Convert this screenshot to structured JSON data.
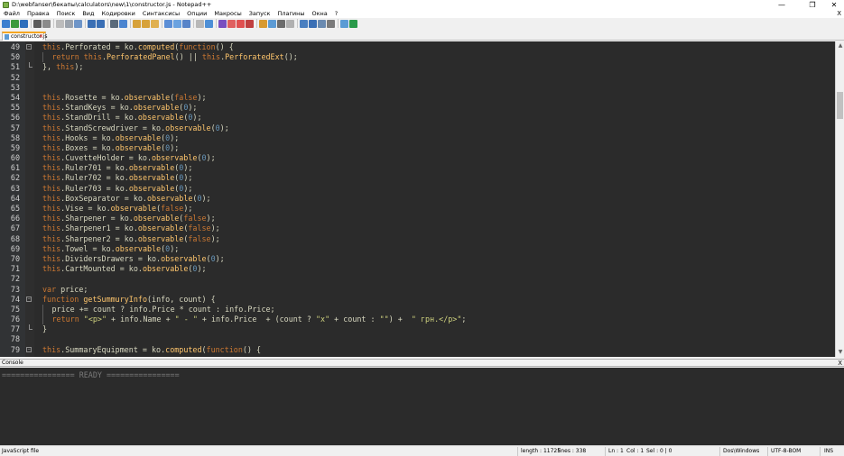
{
  "window": {
    "title": "D:\\webfanser\\бекапы\\calculators\\new\\1\\constructor.js - Notepad++",
    "minimize": "—",
    "maximize": "❐",
    "close": "✕"
  },
  "menu": {
    "items": [
      "Файл",
      "Правка",
      "Поиск",
      "Вид",
      "Кодировки",
      "Синтаксисы",
      "Опции",
      "Макросы",
      "Запуск",
      "Плагины",
      "Окна",
      "?"
    ],
    "close_doc": "X"
  },
  "toolbar": {
    "colors": [
      "#3c7fcf",
      "#3c9a3c",
      "#2c6ebc",
      "#5c5c5c",
      "#8a8a8a",
      "#bcbcbc",
      "#9ba3ad",
      "#6e95c8",
      "#3a6fb5",
      "#3a6fb5",
      "#5a6a7a",
      "#4a84d0",
      "#d7a23a",
      "#d7a23a",
      "#e0b050",
      "#5b8ed6",
      "#6aa2e0",
      "#5784c9",
      "#b8b8b8",
      "#4d8fd6",
      "#7a4fc0",
      "#e06060",
      "#e05050",
      "#c04040",
      "#d89a30",
      "#5c9bd5",
      "#6c6c6c",
      "#b0b0b0",
      "#4a7fc0",
      "#3a6fb5",
      "#6a8ab0",
      "#7a7a7a",
      "#5a9bd5",
      "#2a9a4a"
    ]
  },
  "tabs": [
    {
      "label": "constructor.js",
      "close": "✕"
    }
  ],
  "editor": {
    "lines": [
      {
        "n": "49",
        "fold": "⊟",
        "indent": 0,
        "code": [
          [
            "kw",
            "this"
          ],
          [
            "",
            "."
          ],
          [
            "",
            "Perforated = ko."
          ],
          [
            "fn",
            "computed"
          ],
          [
            "",
            "("
          ],
          [
            "kw",
            "function"
          ],
          [
            "",
            "() {"
          ]
        ]
      },
      {
        "n": "50",
        "indent": 1,
        "code": [
          [
            "kw",
            "return "
          ],
          [
            "kw",
            "this"
          ],
          [
            "",
            "."
          ],
          [
            "fn",
            "PerforatedPanel"
          ],
          [
            "",
            "() || "
          ],
          [
            "kw",
            "this"
          ],
          [
            "",
            "."
          ],
          [
            "fn",
            "PerforatedExt"
          ],
          [
            "",
            "();"
          ]
        ]
      },
      {
        "n": "51",
        "end": true,
        "indent": 0,
        "code": [
          [
            "",
            "}, "
          ],
          [
            "kw",
            "this"
          ],
          [
            "",
            ");"
          ]
        ]
      },
      {
        "n": "52",
        "indent": 0,
        "code": []
      },
      {
        "n": "53",
        "indent": 0,
        "code": []
      },
      {
        "n": "54",
        "indent": 0,
        "code": [
          [
            "kw",
            "this"
          ],
          [
            "",
            ".Rosette = ko."
          ],
          [
            "fn",
            "observable"
          ],
          [
            "",
            "("
          ],
          [
            "kw",
            "false"
          ],
          [
            "",
            ");"
          ]
        ]
      },
      {
        "n": "55",
        "indent": 0,
        "code": [
          [
            "kw",
            "this"
          ],
          [
            "",
            ".StandKeys = ko."
          ],
          [
            "fn",
            "observable"
          ],
          [
            "",
            "("
          ],
          [
            "num",
            "0"
          ],
          [
            "",
            ");"
          ]
        ]
      },
      {
        "n": "56",
        "indent": 0,
        "code": [
          [
            "kw",
            "this"
          ],
          [
            "",
            ".StandDrill = ko."
          ],
          [
            "fn",
            "observable"
          ],
          [
            "",
            "("
          ],
          [
            "num",
            "0"
          ],
          [
            "",
            ");"
          ]
        ]
      },
      {
        "n": "57",
        "indent": 0,
        "code": [
          [
            "kw",
            "this"
          ],
          [
            "",
            ".StandScrewdriver = ko."
          ],
          [
            "fn",
            "observable"
          ],
          [
            "",
            "("
          ],
          [
            "num",
            "0"
          ],
          [
            "",
            ");"
          ]
        ]
      },
      {
        "n": "58",
        "indent": 0,
        "code": [
          [
            "kw",
            "this"
          ],
          [
            "",
            ".Hooks = ko."
          ],
          [
            "fn",
            "observable"
          ],
          [
            "",
            "("
          ],
          [
            "num",
            "0"
          ],
          [
            "",
            ");"
          ]
        ]
      },
      {
        "n": "59",
        "indent": 0,
        "code": [
          [
            "kw",
            "this"
          ],
          [
            "",
            ".Boxes = ko."
          ],
          [
            "fn",
            "observable"
          ],
          [
            "",
            "("
          ],
          [
            "num",
            "0"
          ],
          [
            "",
            ");"
          ]
        ]
      },
      {
        "n": "60",
        "indent": 0,
        "code": [
          [
            "kw",
            "this"
          ],
          [
            "",
            ".CuvetteHolder = ko."
          ],
          [
            "fn",
            "observable"
          ],
          [
            "",
            "("
          ],
          [
            "num",
            "0"
          ],
          [
            "",
            ");"
          ]
        ]
      },
      {
        "n": "61",
        "indent": 0,
        "code": [
          [
            "kw",
            "this"
          ],
          [
            "",
            ".Ruler701 = ko."
          ],
          [
            "fn",
            "observable"
          ],
          [
            "",
            "("
          ],
          [
            "num",
            "0"
          ],
          [
            "",
            ");"
          ]
        ]
      },
      {
        "n": "62",
        "indent": 0,
        "code": [
          [
            "kw",
            "this"
          ],
          [
            "",
            ".Ruler702 = ko."
          ],
          [
            "fn",
            "observable"
          ],
          [
            "",
            "("
          ],
          [
            "num",
            "0"
          ],
          [
            "",
            ");"
          ]
        ]
      },
      {
        "n": "63",
        "indent": 0,
        "code": [
          [
            "kw",
            "this"
          ],
          [
            "",
            ".Ruler703 = ko."
          ],
          [
            "fn",
            "observable"
          ],
          [
            "",
            "("
          ],
          [
            "num",
            "0"
          ],
          [
            "",
            ");"
          ]
        ]
      },
      {
        "n": "64",
        "indent": 0,
        "code": [
          [
            "kw",
            "this"
          ],
          [
            "",
            ".BoxSeparator = ko."
          ],
          [
            "fn",
            "observable"
          ],
          [
            "",
            "("
          ],
          [
            "num",
            "0"
          ],
          [
            "",
            ");"
          ]
        ]
      },
      {
        "n": "65",
        "indent": 0,
        "code": [
          [
            "kw",
            "this"
          ],
          [
            "",
            ".Vise = ko."
          ],
          [
            "fn",
            "observable"
          ],
          [
            "",
            "("
          ],
          [
            "kw",
            "false"
          ],
          [
            "",
            ");"
          ]
        ]
      },
      {
        "n": "66",
        "indent": 0,
        "code": [
          [
            "kw",
            "this"
          ],
          [
            "",
            ".Sharpener = ko."
          ],
          [
            "fn",
            "observable"
          ],
          [
            "",
            "("
          ],
          [
            "kw",
            "false"
          ],
          [
            "",
            ");"
          ]
        ]
      },
      {
        "n": "67",
        "indent": 0,
        "code": [
          [
            "kw",
            "this"
          ],
          [
            "",
            ".Sharpener1 = ko."
          ],
          [
            "fn",
            "observable"
          ],
          [
            "",
            "("
          ],
          [
            "kw",
            "false"
          ],
          [
            "",
            ");"
          ]
        ]
      },
      {
        "n": "68",
        "indent": 0,
        "code": [
          [
            "kw",
            "this"
          ],
          [
            "",
            ".Sharpener2 = ko."
          ],
          [
            "fn",
            "observable"
          ],
          [
            "",
            "("
          ],
          [
            "kw",
            "false"
          ],
          [
            "",
            ");"
          ]
        ]
      },
      {
        "n": "69",
        "indent": 0,
        "code": [
          [
            "kw",
            "this"
          ],
          [
            "",
            ".Towel = ko."
          ],
          [
            "fn",
            "observable"
          ],
          [
            "",
            "("
          ],
          [
            "num",
            "0"
          ],
          [
            "",
            ");"
          ]
        ]
      },
      {
        "n": "70",
        "indent": 0,
        "code": [
          [
            "kw",
            "this"
          ],
          [
            "",
            ".DividersDrawers = ko."
          ],
          [
            "fn",
            "observable"
          ],
          [
            "",
            "("
          ],
          [
            "num",
            "0"
          ],
          [
            "",
            ");"
          ]
        ]
      },
      {
        "n": "71",
        "indent": 0,
        "code": [
          [
            "kw",
            "this"
          ],
          [
            "",
            ".CartMounted = ko."
          ],
          [
            "fn",
            "observable"
          ],
          [
            "",
            "("
          ],
          [
            "num",
            "0"
          ],
          [
            "",
            ");"
          ]
        ]
      },
      {
        "n": "72",
        "indent": 0,
        "code": []
      },
      {
        "n": "73",
        "indent": 0,
        "code": [
          [
            "kw",
            "var "
          ],
          [
            "",
            "price;"
          ]
        ]
      },
      {
        "n": "74",
        "fold": "⊟",
        "indent": 0,
        "code": [
          [
            "kw",
            "function "
          ],
          [
            "fn",
            "getSummuryInfo"
          ],
          [
            "",
            "(info, count) {"
          ]
        ]
      },
      {
        "n": "75",
        "indent": 1,
        "code": [
          [
            "",
            "price += count ? info.Price * count : info.Price;"
          ]
        ]
      },
      {
        "n": "76",
        "indent": 1,
        "code": [
          [
            "kw",
            "return "
          ],
          [
            "str",
            "\"<p>\""
          ],
          [
            "",
            " + info.Name + "
          ],
          [
            "str",
            "\" - \""
          ],
          [
            "",
            " + info.Price  + (count ? "
          ],
          [
            "str",
            "\"x\""
          ],
          [
            "",
            " + count : "
          ],
          [
            "str",
            "\"\""
          ],
          [
            "",
            ") +  "
          ],
          [
            "str",
            "\" грн.</p>\""
          ],
          [
            "",
            ";"
          ]
        ]
      },
      {
        "n": "77",
        "end": true,
        "indent": 0,
        "code": [
          [
            "",
            "}"
          ]
        ]
      },
      {
        "n": "78",
        "indent": 0,
        "code": []
      },
      {
        "n": "79",
        "fold": "⊟",
        "indent": 0,
        "code": [
          [
            "kw",
            "this"
          ],
          [
            "",
            ".SummaryEquipment = ko."
          ],
          [
            "fn",
            "computed"
          ],
          [
            "",
            "("
          ],
          [
            "kw",
            "function"
          ],
          [
            "",
            "() {"
          ]
        ]
      }
    ]
  },
  "scroll": {
    "up": "▲",
    "down": "▼"
  },
  "console": {
    "title": "Console",
    "close": "X",
    "output": "================ READY ================"
  },
  "status": {
    "file_type": "JavaScript file",
    "length": "length : 11725",
    "lines": "lines : 338",
    "ln": "Ln : 1",
    "col": "Col : 1",
    "sel": "Sel : 0 | 0",
    "eol": "Dos\\Windows",
    "encoding": "UTF-8-BOM",
    "mode": "INS"
  }
}
